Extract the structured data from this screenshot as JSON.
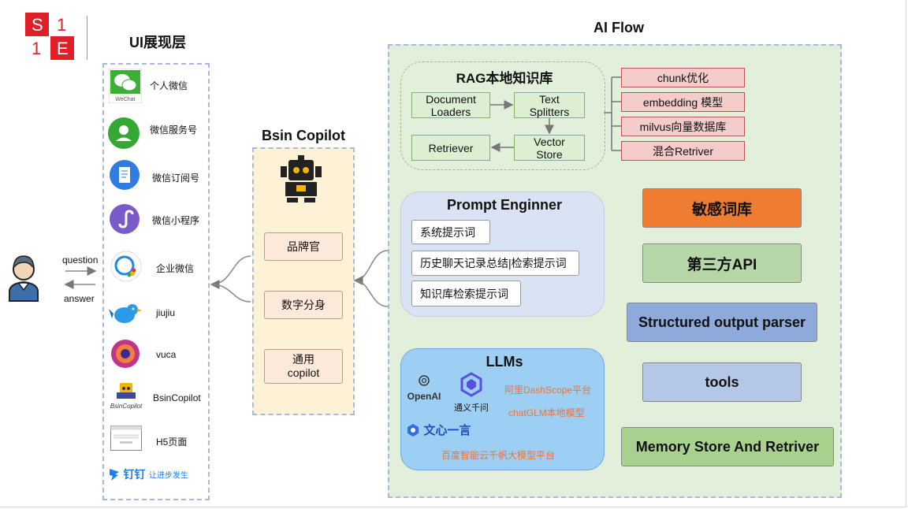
{
  "logo": {
    "text": "S1 1E"
  },
  "sections": {
    "ui_layer": "UI展现层",
    "bsin_copilot": "Bsin Copilot",
    "ai_flow": "AI Flow"
  },
  "user": {
    "question": "question",
    "answer": "answer"
  },
  "ui_items": [
    {
      "label": "个人微信",
      "icon": "wechat-icon"
    },
    {
      "label": "微信服务号",
      "icon": "service-account-icon"
    },
    {
      "label": "微信订阅号",
      "icon": "subscription-icon"
    },
    {
      "label": "微信小程序",
      "icon": "mini-program-icon"
    },
    {
      "label": "企业微信",
      "icon": "wecom-icon"
    },
    {
      "label": "jiujiu",
      "icon": "bird-icon"
    },
    {
      "label": "vuca",
      "icon": "vuca-icon"
    },
    {
      "label": "BsinCopilot",
      "icon": "bsincopilot-icon"
    },
    {
      "label": "H5页面",
      "icon": "h5-page-icon"
    }
  ],
  "wechat_caption": "WeChat",
  "bsin_caption": "BsinCopilot",
  "dingtalk": {
    "brand": "钉钉",
    "slogan": "让进步发生"
  },
  "copilot_items": [
    "品牌官",
    "数字分身",
    "通用\ncopilot"
  ],
  "rag": {
    "title": "RAG本地知识库",
    "document_loaders": "Document\nLoaders",
    "text_splitters": "Text\nSplitters",
    "retriever": "Retriever",
    "vector_store": "Vector\nStore",
    "options": [
      "chunk优化",
      "embedding 模型",
      "milvus向量数据库",
      "混合Retriver"
    ]
  },
  "prompt": {
    "title": "Prompt Enginner",
    "items": [
      "系统提示词",
      "历史聊天记录总结|检索提示词",
      "知识库检索提示词"
    ]
  },
  "llms": {
    "title": "LLMs",
    "openai": "OpenAI",
    "tongyi": "通义千问",
    "dashscope": "阿里DashScope平台",
    "chatglm": "chatGLM本地模型",
    "wenxin": "文心一言",
    "baidu": "百度智能云千帆大模型平台"
  },
  "right_boxes": {
    "sensitive": "敏感词库",
    "third_party": "第三方API",
    "parser": "Structured output parser",
    "tools": "tools",
    "memory": "Memory Store And Retriver"
  },
  "colors": {
    "sensitive": "#ee7d31",
    "third_party": "#b6d7a8",
    "parser": "#8eaadb",
    "tools": "#b4c7e7",
    "memory": "#a9d18e",
    "ai_flow_bg": "#e2efda",
    "llm_bg": "#9dcff5",
    "copilot_bg": "#fdf1d6"
  }
}
